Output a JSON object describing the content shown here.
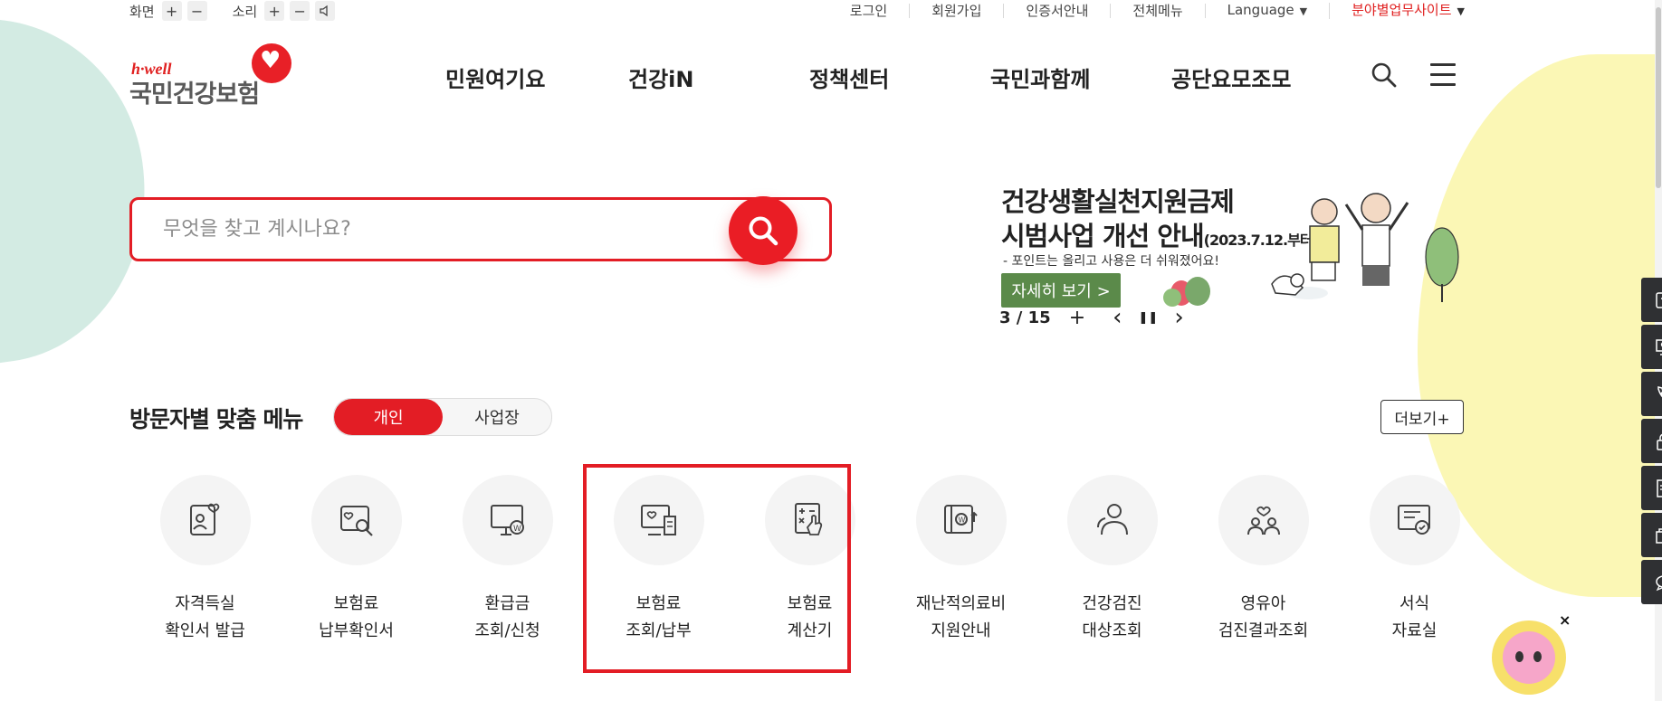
{
  "utility": {
    "screen_label": "화면",
    "sound_label": "소리",
    "plus": "+",
    "minus": "−",
    "links": [
      "로그인",
      "회원가입",
      "인증서안내",
      "전체메뉴"
    ],
    "language": "Language",
    "field_sites": "분야별업무사이트"
  },
  "logo": {
    "hwell": "h·well",
    "name": "국민건강보험"
  },
  "gnb": [
    "민원여기요",
    "건강iN",
    "정책센터",
    "국민과함께",
    "공단요모조모"
  ],
  "search": {
    "placeholder": "무엇을 찾고 계시나요?"
  },
  "banner": {
    "title_line1": "건강생활실천지원금제",
    "title_line2": "시범사업 개선 안내",
    "title_date": "(2023.7.12.부터)",
    "subtitle": "- 포인트는 올리고 사용은 더 쉬워졌어요!",
    "more": "자세히 보기 >",
    "counter": "3 / 15",
    "add": "+",
    "prev": "‹",
    "pause": "❚❚",
    "next": "›"
  },
  "visitor_menu": {
    "title": "방문자별 맞춤 메뉴",
    "tab_individual": "개인",
    "tab_business": "사업장",
    "more": "더보기+"
  },
  "menu_items": [
    {
      "line1": "자격득실",
      "line2": "확인서 발급",
      "icon": "id-card-heart-icon"
    },
    {
      "line1": "보험료",
      "line2": "납부확인서",
      "icon": "document-search-icon"
    },
    {
      "line1": "환급금",
      "line2": "조회/신청",
      "icon": "monitor-won-icon"
    },
    {
      "line1": "보험료",
      "line2": "조회/납부",
      "icon": "monitor-receipt-icon"
    },
    {
      "line1": "보험료",
      "line2": "계산기",
      "icon": "calculator-hand-icon"
    },
    {
      "line1": "재난적의료비",
      "line2": "지원안내",
      "icon": "wallet-won-icon"
    },
    {
      "line1": "건강검진",
      "line2": "대상조회",
      "icon": "people-search-icon"
    },
    {
      "line1": "영유아",
      "line2": "검진결과조회",
      "icon": "family-heart-icon"
    },
    {
      "line1": "서식",
      "line2": "자료실",
      "icon": "form-check-icon"
    }
  ],
  "quick_menu": [
    "phone-card-icon",
    "monitor-person-icon",
    "phone-call-icon",
    "lock-icon",
    "document-icon",
    "windows-icon",
    "chat-icon"
  ],
  "colors": {
    "brand_red": "#e31d25",
    "banner_green": "#5b8a4a",
    "quick_dark": "#2f3033"
  }
}
